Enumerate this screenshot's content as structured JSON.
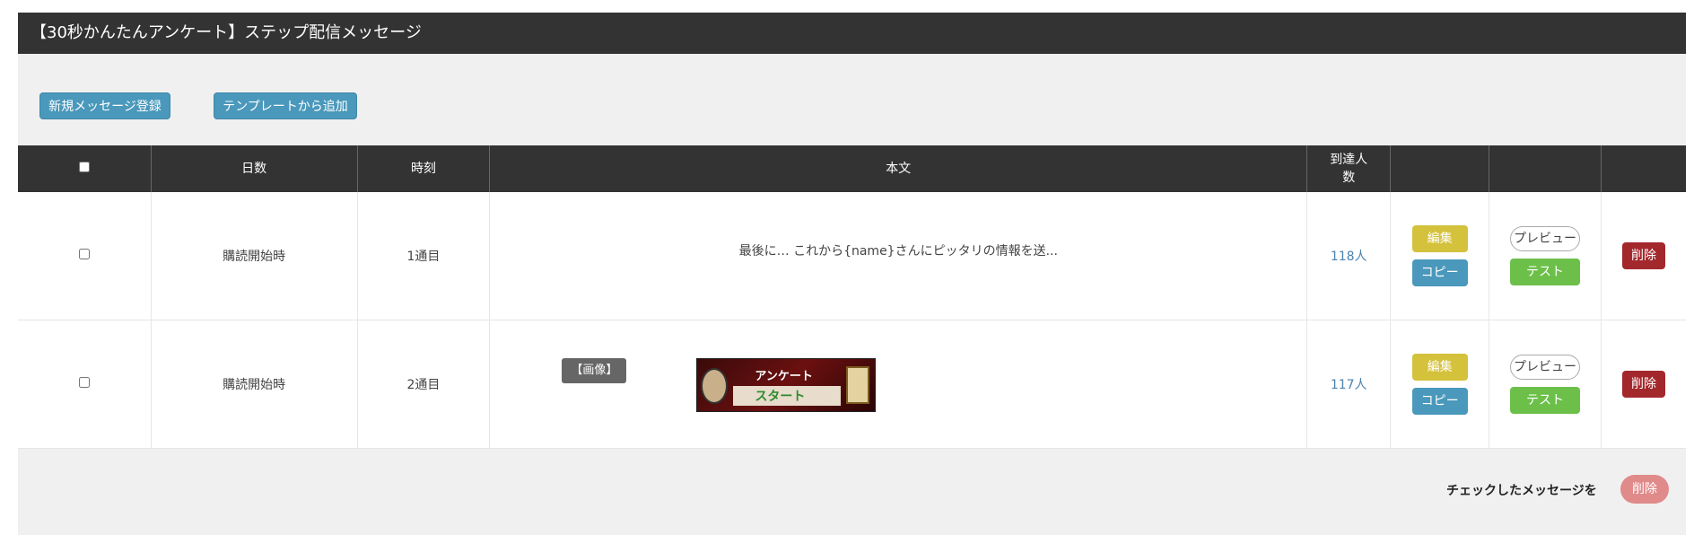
{
  "page": {
    "title": "【30秒かんたんアンケート】ステップ配信メッセージ"
  },
  "toolbar": {
    "new_message": "新規メッセージ登録",
    "from_template": "テンプレートから追加"
  },
  "table": {
    "headers": {
      "checkbox": "",
      "days": "日数",
      "time": "時刻",
      "body": "本文",
      "reach": "到達人数"
    },
    "rows": [
      {
        "days": "購読開始時",
        "time": "1通目",
        "body": "最後に… これから{name}さんにピッタリの情報を送...",
        "reach": "118人"
      },
      {
        "days": "購読開始時",
        "time": "2通目",
        "body_badge": "【画像】",
        "banner_line1": "アンケート",
        "banner_line2": "スタート",
        "reach": "117人"
      }
    ],
    "actions": {
      "edit": "編集",
      "copy": "コピー",
      "preview": "プレビュー",
      "test": "テスト",
      "delete": "削除"
    }
  },
  "footer": {
    "label": "チェックしたメッセージを",
    "delete": "削除"
  },
  "colors": {
    "header_bg": "#333333",
    "primary": "#4a98bb",
    "edit": "#d4c13c",
    "test": "#6cc04a",
    "delete": "#a3282c",
    "reach_link": "#4a83b0"
  }
}
